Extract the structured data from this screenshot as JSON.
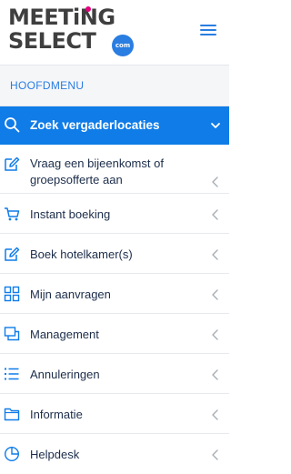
{
  "brand": {
    "line1": "MEETiNG",
    "line2": "SELECT",
    "badge": "com"
  },
  "colors": {
    "accent": "#0f7ce8",
    "brand_blue": "#2a7de1",
    "brand_pink": "#e5007d",
    "text": "#1c2d4a"
  },
  "menu": {
    "heading": "HOOFDMENU",
    "items": [
      {
        "label": "Zoek vergaderlocaties",
        "icon": "search-icon",
        "active": true,
        "chevron": "chevron-down-icon"
      },
      {
        "label": "Vraag een bijeenkomst of groepsofferte aan",
        "icon": "edit-icon",
        "chevron": "chevron-left-icon"
      },
      {
        "label": "Instant boeking",
        "icon": "cart-icon",
        "chevron": "chevron-left-icon"
      },
      {
        "label": "Boek hotelkamer(s)",
        "icon": "edit-icon",
        "chevron": "chevron-left-icon"
      },
      {
        "label": "Mijn aanvragen",
        "icon": "grid-icon",
        "chevron": "chevron-left-icon"
      },
      {
        "label": "Management",
        "icon": "windows-icon",
        "chevron": "chevron-left-icon"
      },
      {
        "label": "Annuleringen",
        "icon": "list-icon",
        "chevron": "chevron-left-icon"
      },
      {
        "label": "Informatie",
        "icon": "folder-icon",
        "chevron": "chevron-left-icon"
      },
      {
        "label": "Helpdesk",
        "icon": "pie-chart-icon",
        "chevron": "chevron-left-icon"
      }
    ]
  }
}
